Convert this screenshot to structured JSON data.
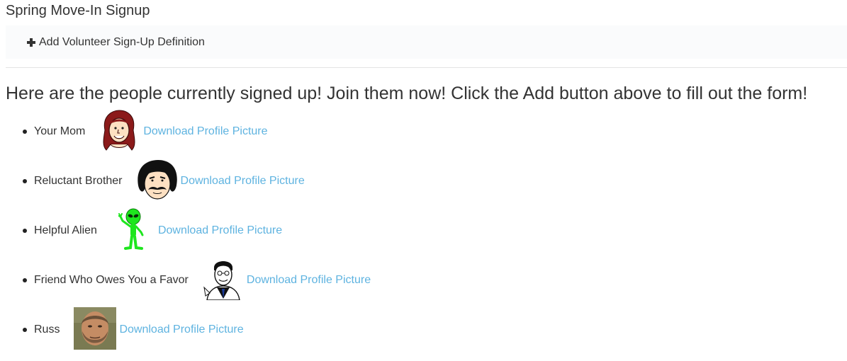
{
  "page": {
    "title": "Spring Move-In Signup"
  },
  "toolbar": {
    "add_label": "Add Volunteer Sign-Up Definition",
    "add_icon": "plus-icon"
  },
  "intro_text": "Here are the people currently signed up! Join them now! Click the Add button above to fill out the form!",
  "signups": [
    {
      "name": "Your Mom",
      "avatar": "long-haired-woman-cartoon",
      "link": "Download Profile Picture"
    },
    {
      "name": "Reluctant Brother",
      "avatar": "mustached-man-cartoon",
      "link": "Download Profile Picture"
    },
    {
      "name": "Helpful Alien",
      "avatar": "green-alien-cartoon",
      "link": "Download Profile Picture"
    },
    {
      "name": "Friend Who Owes You a Favor",
      "avatar": "man-in-suit-cartoon",
      "link": "Download Profile Picture"
    },
    {
      "name": "Russ",
      "avatar": "bearded-man-photo",
      "link": "Download Profile Picture"
    }
  ],
  "colors": {
    "text": "#333333",
    "link": "#5eb3e0",
    "toolbar_bg": "#fafbfc"
  }
}
